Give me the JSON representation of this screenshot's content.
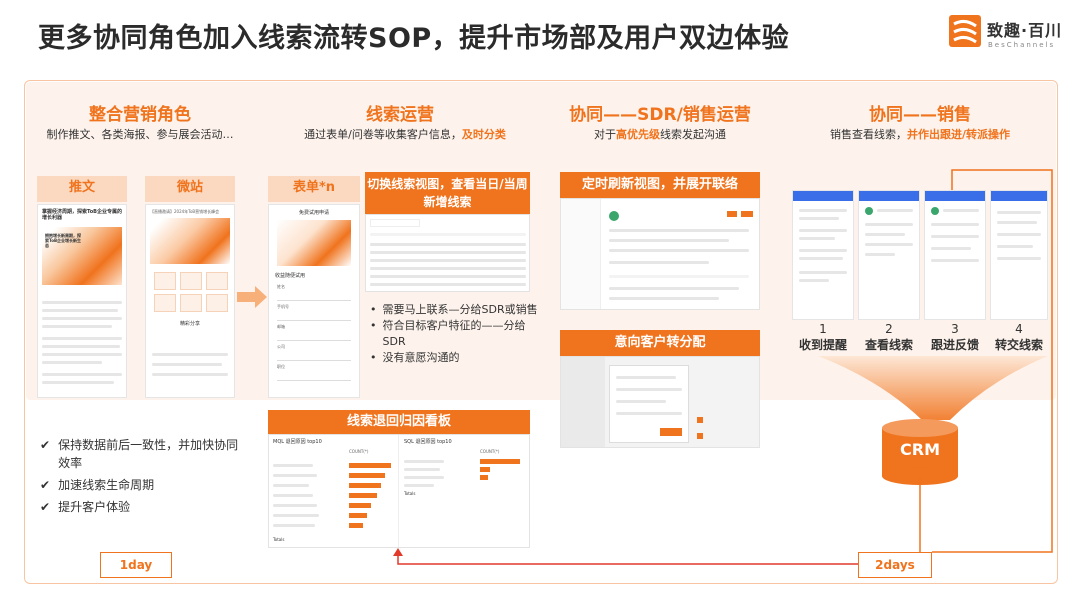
{
  "title": "更多协同角色加入线索流转SOP，提升市场部及用户双边体验",
  "logo": {
    "name": "致趣·百川",
    "sub": "BesChannels"
  },
  "sections": [
    {
      "title": "整合营销角色",
      "sub_plain": "制作推文、各类海报、参与展会活动…",
      "sub_highlight": ""
    },
    {
      "title": "线索运营",
      "sub_plain": "通过表单/问卷等收集客户信息，",
      "sub_highlight": "及时分类"
    },
    {
      "title": "协同——SDR/销售运营",
      "sub_plain": "对于",
      "sub_highlight": "高优先级",
      "sub_tail": "线索发起沟通"
    },
    {
      "title": "协同——销售",
      "sub_plain": "销售查看线索，",
      "sub_highlight": "并作出跟进/转派操作"
    }
  ],
  "cards": {
    "tuiwen": "推文",
    "weizhan": "微站",
    "biaodan": "表单*n",
    "switch_view": "切换线索视图，查看当日/当周新增线索",
    "refresh_view": "定时刷新视图，并展开联络",
    "intent_assign": "意向客户转分配",
    "return_board": "线索退回归因看板"
  },
  "article": {
    "headline": "掌握经济周期，探索ToB企业专属的增长利器",
    "banner_title": "拥抱增长新周期，探索ToB企业增长新生态"
  },
  "microsite": {
    "banner": "【直播邀请】2024年ToB营销增长峰会",
    "section": "精彩分享",
    "tiles": [
      "",
      "",
      "",
      "",
      "",
      ""
    ]
  },
  "form": {
    "header": "免费试用申请",
    "labels": [
      "收益随便试用",
      "姓名",
      "手机号",
      "邮箱",
      "公司",
      "职位"
    ]
  },
  "ops_bullets": [
    "需要马上联系—分给SDR或销售",
    "符合目标客户特征的——分给SDR",
    "没有意愿沟通的"
  ],
  "benefits": [
    "保持数据前后一致性，并加快协同效率",
    "加速线索生命周期",
    "提升客户体验"
  ],
  "badges": {
    "left": "1day",
    "right": "2days"
  },
  "steps": [
    {
      "num": "1",
      "label": "收到提醒"
    },
    {
      "num": "2",
      "label": "查看线索"
    },
    {
      "num": "3",
      "label": "跟进反馈"
    },
    {
      "num": "4",
      "label": "转交线索"
    }
  ],
  "crm": "CRM",
  "board": {
    "left_title": "MQL 退回原因 top10",
    "right_title": "SQL 退回原因 top10",
    "count_label": "COUNT(*)",
    "total_label": "Totals"
  },
  "colors": {
    "accent": "#f0731d",
    "pale": "#fbd9c0",
    "band": "#fdf3ec"
  }
}
